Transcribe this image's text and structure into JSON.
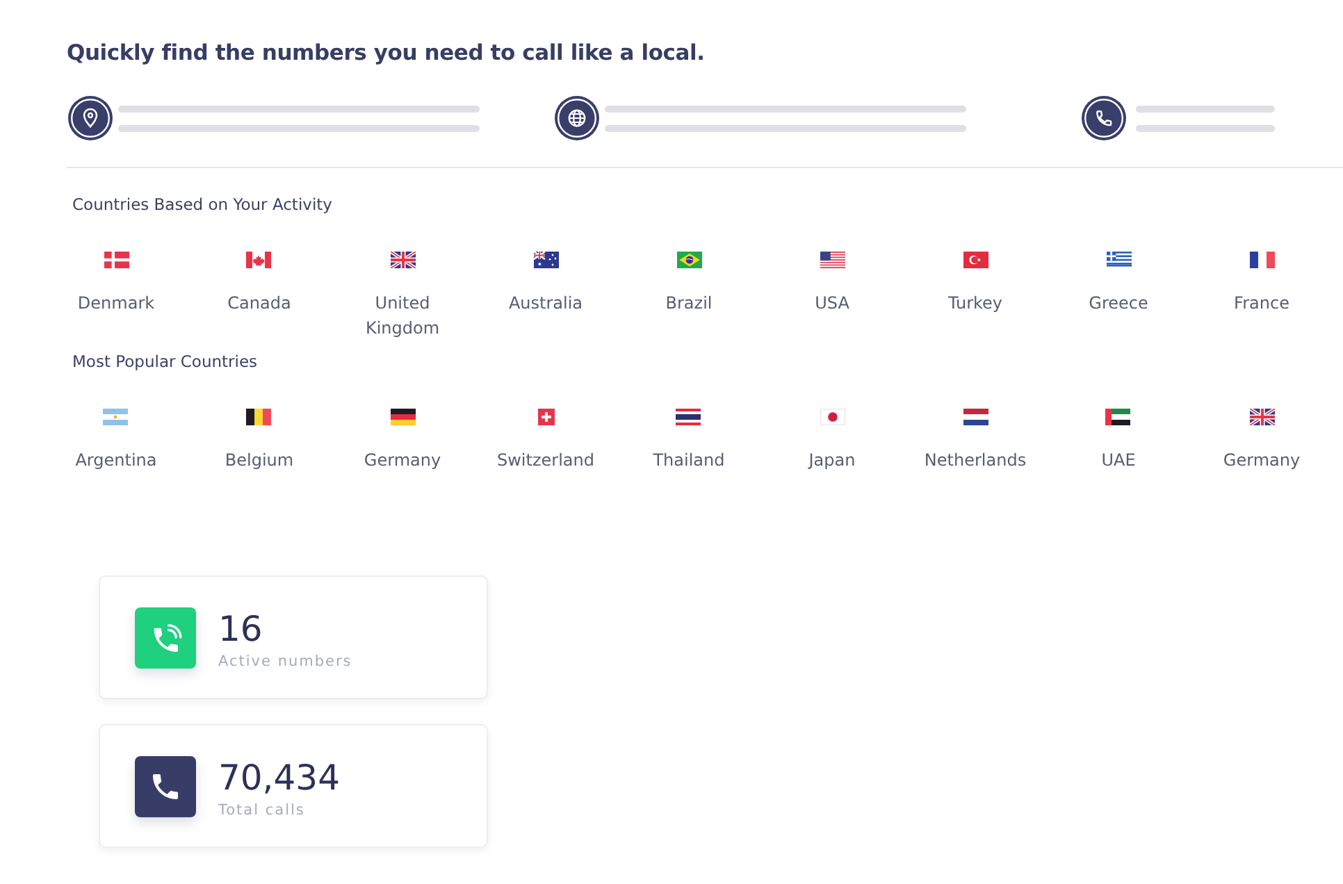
{
  "heading": "Quickly find the numbers you need to call like a local.",
  "features": [
    {
      "kind": "location"
    },
    {
      "kind": "globe"
    },
    {
      "kind": "phone"
    }
  ],
  "sections": [
    {
      "title": "Countries Based on Your Activity",
      "countries": [
        {
          "name": "Denmark",
          "kind": "dk"
        },
        {
          "name": "Canada",
          "kind": "ca"
        },
        {
          "name": "United Kingdom",
          "kind": "gb"
        },
        {
          "name": "Australia",
          "kind": "au"
        },
        {
          "name": "Brazil",
          "kind": "br"
        },
        {
          "name": "USA",
          "kind": "us"
        },
        {
          "name": "Turkey",
          "kind": "tr"
        },
        {
          "name": "Greece",
          "kind": "gr"
        },
        {
          "name": "France",
          "kind": "fr"
        }
      ]
    },
    {
      "title": "Most Popular Countries",
      "countries": [
        {
          "name": "Argentina",
          "kind": "ar"
        },
        {
          "name": "Belgium",
          "kind": "be"
        },
        {
          "name": "Germany",
          "kind": "de"
        },
        {
          "name": "Switzerland",
          "kind": "ch"
        },
        {
          "name": "Thailand",
          "kind": "th"
        },
        {
          "name": "Japan",
          "kind": "jp"
        },
        {
          "name": "Netherlands",
          "kind": "nl"
        },
        {
          "name": "UAE",
          "kind": "ae"
        },
        {
          "name": "Germany",
          "kind": "gb"
        }
      ]
    }
  ],
  "stats": [
    {
      "kind": "active",
      "value": "16",
      "label": "Active numbers"
    },
    {
      "kind": "total",
      "value": "70,434",
      "label": "Total calls"
    }
  ]
}
